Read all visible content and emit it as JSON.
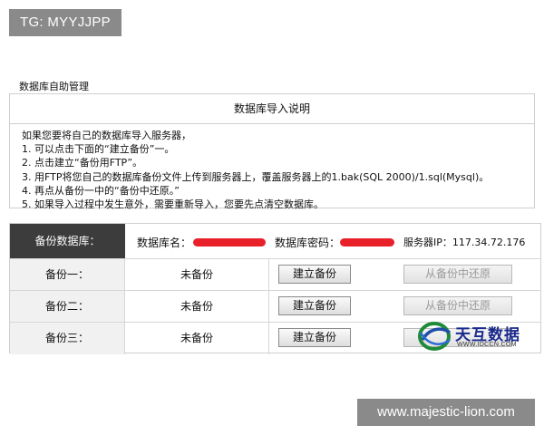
{
  "watermarks": {
    "top_left": "TG: MYYJJPP",
    "bottom_right": "www.majestic-lion.com"
  },
  "page": {
    "title": "数据库自助管理"
  },
  "info": {
    "header": "数据库导入说明",
    "lines": [
      "如果您要将自己的数据库导入服务器，",
      "1. 可以点击下面的“建立备份”一。",
      "2. 点击建立“备份用FTP”。",
      "3. 用FTP将您自己的数据库备份文件上传到服务器上，覆盖服务器上的1.bak(SQL 2000)/1.sql(Mysql)。",
      "4. 再点从备份一中的“备份中还原。”",
      "5. 如果导入过程中发生意外，需要重新导入，您要先点清空数据库。"
    ]
  },
  "backup": {
    "header_label": "备份数据库：",
    "db_name_label": "数据库名：",
    "db_password_label": "数据库密码：",
    "server_ip_label": "服务器IP：117.34.72.176",
    "redaction_color": "#e8202a",
    "rows": [
      {
        "label": "备份一：",
        "status": "未备份",
        "create_label": "建立备份",
        "restore_label": "从备份中还原"
      },
      {
        "label": "备份二：",
        "status": "未备份",
        "create_label": "建立备份",
        "restore_label": "从备份中还原"
      },
      {
        "label": "备份三：",
        "status": "未备份",
        "create_label": "建立备份",
        "restore_label": ""
      }
    ]
  },
  "logo": {
    "text": "天互数据",
    "url": "WWW.IDCCN.COM"
  }
}
